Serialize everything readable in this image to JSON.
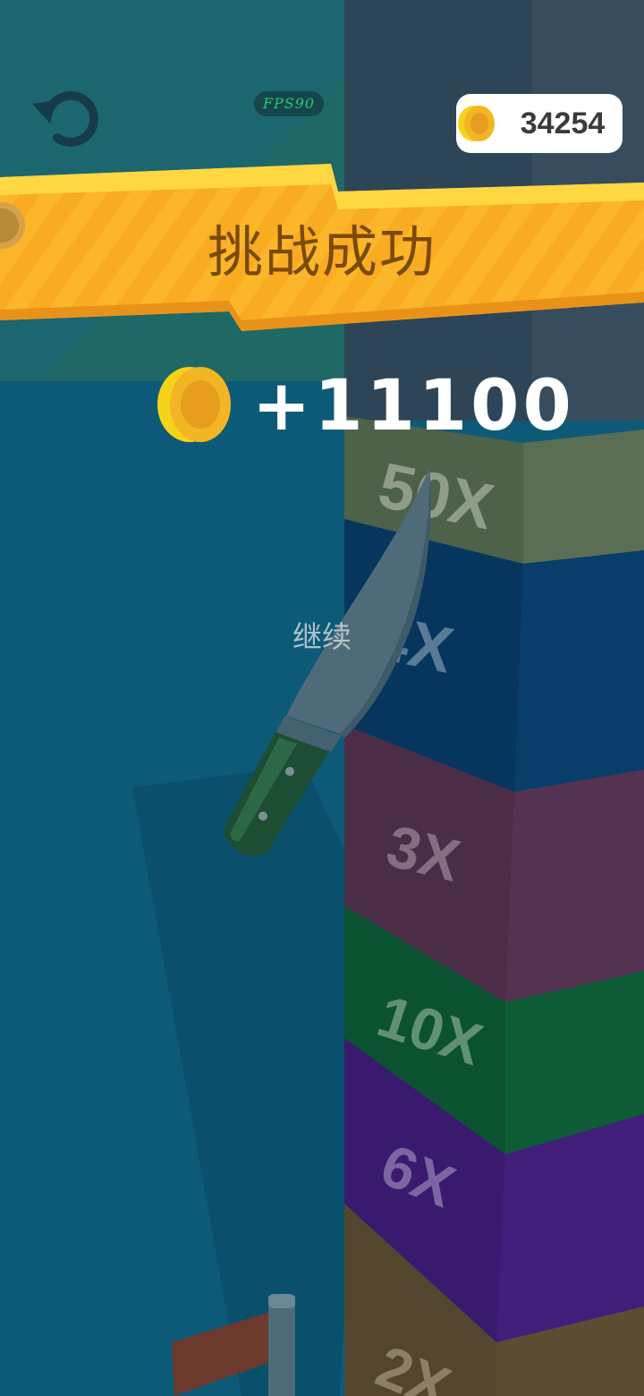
{
  "hud": {
    "fps_label": "FPS90",
    "coin_total": "34254"
  },
  "banner": {
    "title": "挑战成功"
  },
  "reward": {
    "amount": "+11100"
  },
  "continue_label": "继续",
  "tower": {
    "multipliers": [
      "50X",
      "4X",
      "3X",
      "10X",
      "6X",
      "2X"
    ],
    "colors": [
      "#4d6249",
      "#06365d",
      "#4b2d48",
      "#0b5330",
      "#3a1a6e",
      "#54452e"
    ]
  },
  "colors": {
    "water": "#0d5a78",
    "sky": "#1c6670",
    "banner_yellow": "#fbb62a",
    "banner_text": "#7a4a08",
    "coin_gold": "#f2b624",
    "fps_green": "#27c96a"
  }
}
